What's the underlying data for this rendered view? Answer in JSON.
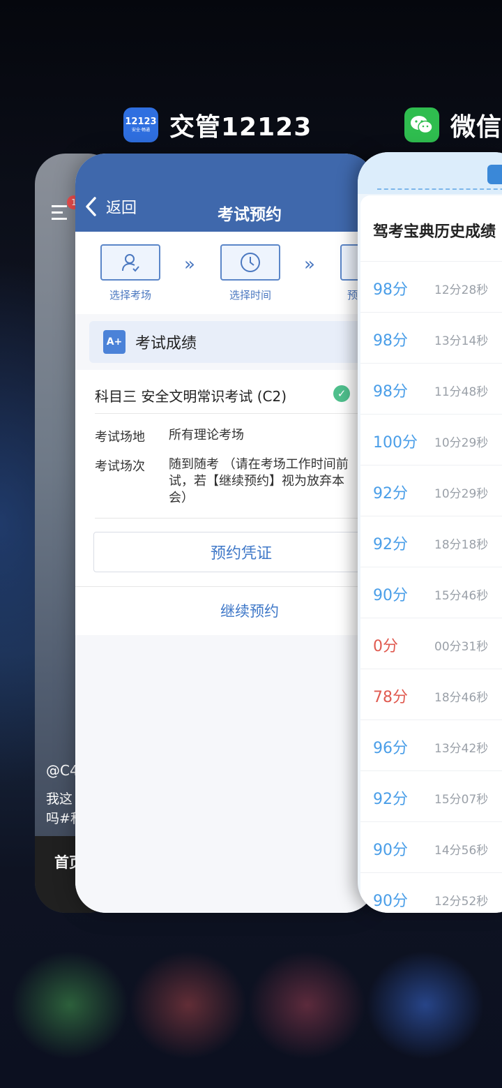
{
  "apps": [
    {
      "name": "交管12123",
      "icon": "app-12123-icon",
      "icon_text": "12123",
      "icon_sub": "安全·畅通",
      "color": "#2f6fe0"
    },
    {
      "name": "微信",
      "icon": "wechat-icon",
      "color": "#2fbd4f"
    }
  ],
  "back_card": {
    "badge": "1",
    "handle": "@C4",
    "text1": "我这",
    "text2": "吗#私",
    "tab": "首页"
  },
  "main": {
    "back_label": "返回",
    "title": "考试预约",
    "steps": [
      "选择考场",
      "选择时间",
      "预"
    ],
    "score_header": "考试成绩",
    "score_icon_text": "A+",
    "subject": "科目三 安全文明常识考试 (C2)",
    "check_text": "✓",
    "venue_label": "考试场地",
    "venue_value": "所有理论考场",
    "session_label": "考试场次",
    "session_value": "随到随考 （请在考场工作时间前\n试，若【继续预约】视为放弃本\n会）",
    "voucher_button": "预约凭证",
    "continue_button": "继续预约"
  },
  "wechat": {
    "title": "驾考宝典历史成绩",
    "records": [
      {
        "score": "98分",
        "time": "12分28秒",
        "fail": false
      },
      {
        "score": "98分",
        "time": "13分14秒",
        "fail": false
      },
      {
        "score": "98分",
        "time": "11分48秒",
        "fail": false
      },
      {
        "score": "100分",
        "time": "10分29秒",
        "fail": false
      },
      {
        "score": "92分",
        "time": "10分29秒",
        "fail": false
      },
      {
        "score": "92分",
        "time": "18分18秒",
        "fail": false
      },
      {
        "score": "90分",
        "time": "15分46秒",
        "fail": false
      },
      {
        "score": "0分",
        "time": "00分31秒",
        "fail": true
      },
      {
        "score": "78分",
        "time": "18分46秒",
        "fail": true
      },
      {
        "score": "96分",
        "time": "13分42秒",
        "fail": false
      },
      {
        "score": "92分",
        "time": "15分07秒",
        "fail": false
      },
      {
        "score": "90分",
        "time": "14分56秒",
        "fail": false
      },
      {
        "score": "90分",
        "time": "12分52秒",
        "fail": false
      }
    ]
  }
}
